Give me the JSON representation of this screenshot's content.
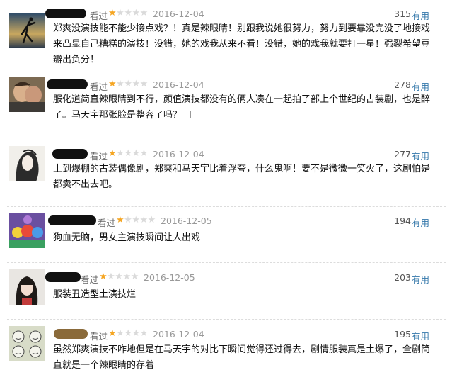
{
  "useful_label": "有用",
  "star_on": "★",
  "star_off": "★",
  "reviews": [
    {
      "status": "看过",
      "rating": 1,
      "date": "2016-12-04",
      "votes": "315",
      "text": "郑爽没演技能不能少接点戏？！真是辣眼睛！别跟我说她很努力，努力到要靠没完没了地接戏来凸显自己糟糕的演技！没错，她的戏我从来不看！没错，她的戏我就要打一星！强裂希望豆瓣出负分！"
    },
    {
      "status": "看过",
      "rating": 1,
      "date": "2016-12-04",
      "votes": "278",
      "text": "服化道简直辣眼睛到不行，颜值演技都没有的俩人凑在一起拍了部上个世纪的古装剧，也是醉了。马天宇那张脸是整容了吗？"
    },
    {
      "status": "看过",
      "rating": 1,
      "date": "2016-12-04",
      "votes": "277",
      "text": "土到爆棚的古装偶像剧，郑爽和马天宇比着浮夸，什么鬼啊！要不是微微一笑火了，这剧怕是都卖不出去吧。"
    },
    {
      "status": "看过",
      "rating": 1,
      "date": "2016-12-05",
      "votes": "194",
      "text": "狗血无脑，男女主演技瞬间让人出戏"
    },
    {
      "status": "看过",
      "rating": 1,
      "date": "2016-12-05",
      "votes": "203",
      "text": "服装丑造型土演技烂"
    },
    {
      "status": "看过",
      "rating": 1,
      "date": "2016-12-04",
      "votes": "195",
      "text": "虽然郑爽演技不咋地但是在马天宇的对比下瞬间觉得还过得去，剧情服装真是土爆了，全剧简直就是一个辣眼睛的存着"
    }
  ]
}
